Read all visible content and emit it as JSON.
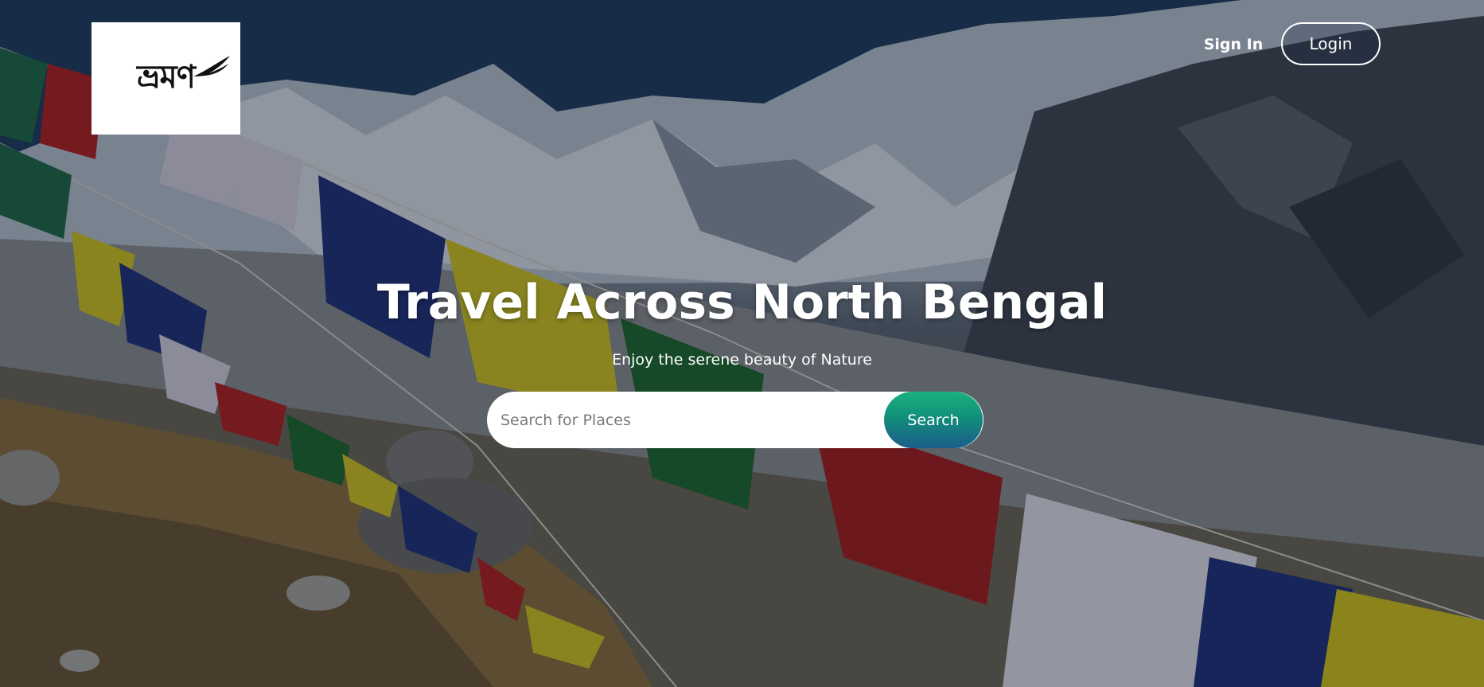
{
  "header": {
    "logo_text": "ভ্রমণ",
    "signin_label": "Sign In",
    "login_label": "Login"
  },
  "hero": {
    "title": "Travel Across North Bengal",
    "subtitle": "Enjoy the serene beauty of Nature",
    "background_description": "prayer-flags-over-snowy-himalayan-mountains"
  },
  "search": {
    "placeholder": "Search for Places",
    "value": "",
    "button_label": "Search"
  },
  "colors": {
    "search_button_top": "#19b27f",
    "search_button_bottom": "#1b5d8a",
    "text": "#ffffff",
    "logo_background": "#ffffff"
  }
}
